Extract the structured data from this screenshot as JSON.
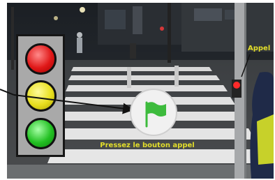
{
  "press_instruction": "Pressez le bouton appel",
  "callout_label": "Appel",
  "icons": {
    "traffic_light": "traffic-light-icon",
    "go_button": "green-flag-icon"
  },
  "colors": {
    "label_yellow": "#e3de2a",
    "lamp_red": "#e01818",
    "lamp_yellow": "#e8df1f",
    "lamp_green": "#22c022",
    "flag_green": "#3dbb3d"
  }
}
